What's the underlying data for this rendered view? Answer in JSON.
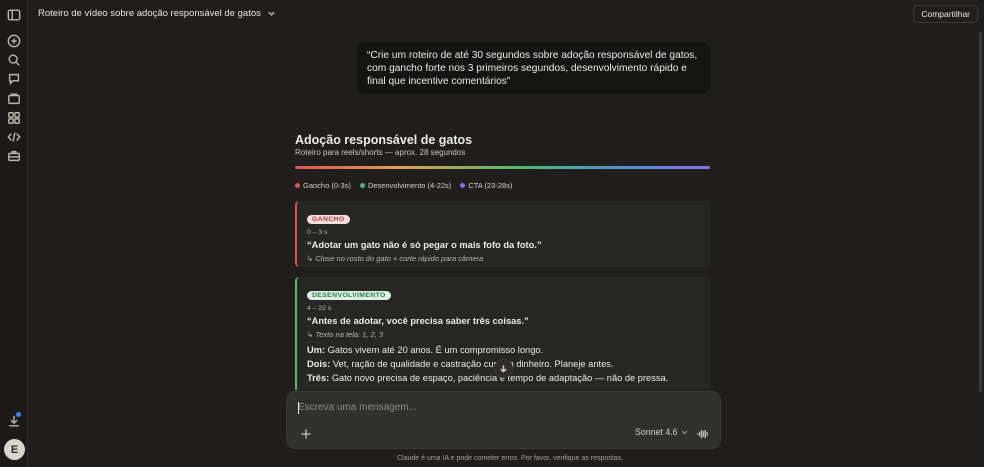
{
  "header": {
    "title": "Roteiro de vídeo sobre adoção responsável de gatos",
    "share_label": "Compartilhar"
  },
  "sidebar": {
    "icons": [
      "sidebar-toggle-icon",
      "new-chat-icon",
      "search-icon",
      "chats-icon",
      "projects-icon",
      "artifacts-icon",
      "code-icon",
      "briefcase-icon"
    ],
    "avatar_initial": "E"
  },
  "user_message": "“Crie um roteiro de até 30 segundos sobre adoção responsável de gatos, com gancho forte nos 3 primeiros segundos, desenvolvimento rápido e final que incentive comentários”",
  "artifact": {
    "title": "Adoção responsável de gatos",
    "subtitle": "Roteiro para reels/shorts — aprox. 28 segundos",
    "legend": [
      {
        "label": "Gancho (0-3s)",
        "color": "#e05252"
      },
      {
        "label": "Desenvolvimento (4-22s)",
        "color": "#4fb872"
      },
      {
        "label": "CTA (23-28s)",
        "color": "#8a6fe0"
      }
    ],
    "sections": [
      {
        "badge": "GANCHO",
        "time": "0 – 3 s",
        "quote_pre": "“Adotar um gato ",
        "quote_bold": "não é",
        "quote_post": " só pegar o mais fofo da foto.”",
        "note": "↳ Close no rosto do gato + corte rápido para câmera"
      },
      {
        "badge": "DESENVOLVIMENTO",
        "time": "4 – 22 s",
        "quote": "“Antes de adotar, você precisa saber três coisas.”",
        "note": "↳ Texto na tela: 1, 2, 3",
        "lines": [
          {
            "label": "Um:",
            "text": " Gatos vivem até 20 anos. É um compromisso longo."
          },
          {
            "label": "Dois:",
            "text": " Vet, ração de qualidade e castração custam dinheiro. Planeje antes."
          },
          {
            "label": "Três:",
            "text": " Gato novo precisa de espaço, paciência e tempo de adaptação — não de pressa."
          }
        ]
      }
    ]
  },
  "composer": {
    "placeholder": "Escreva uma mensagem...",
    "model": "Sonnet 4.6"
  },
  "disclaimer": "Claude é uma IA e pode cometer erros. Por favor, verifique as respostas.",
  "colors": {
    "hook": "#e05252",
    "development": "#4fb872",
    "cta": "#8a6fe0",
    "notification": "#3b82f6"
  }
}
